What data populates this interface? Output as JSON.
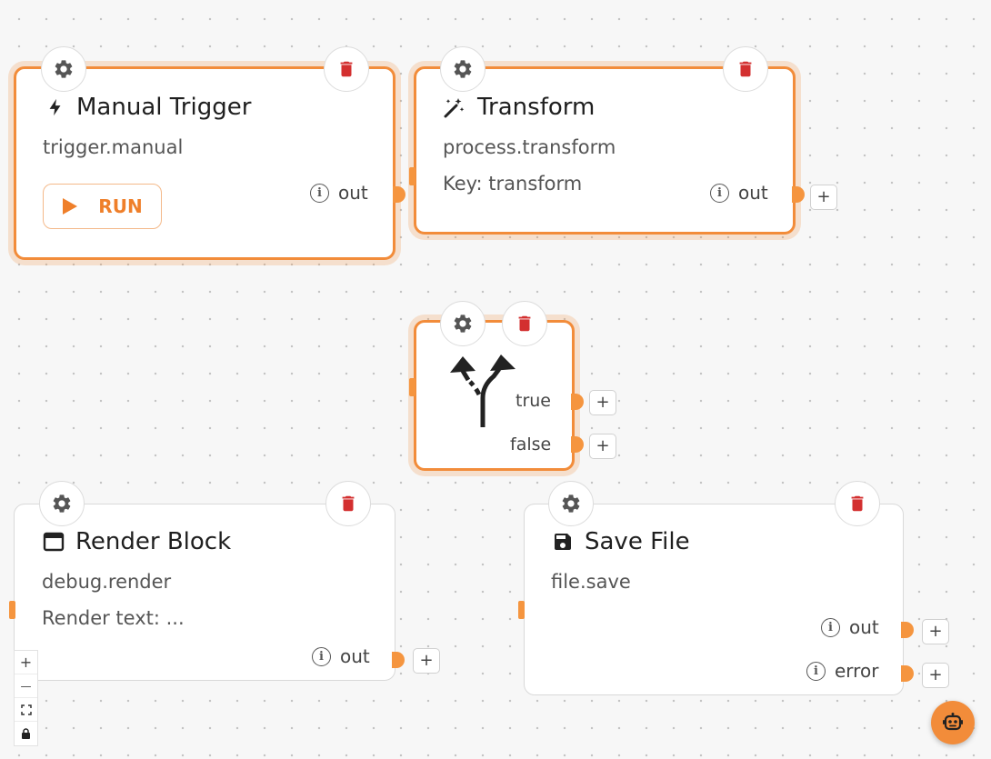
{
  "nodes": {
    "manual_trigger": {
      "title": "Manual Trigger",
      "type": "trigger.manual",
      "run_label": "RUN",
      "output": "out"
    },
    "transform": {
      "title": "Transform",
      "type": "process.transform",
      "detail": "Key: transform",
      "output": "out"
    },
    "condition": {
      "true_label": "true",
      "false_label": "false"
    },
    "render_block": {
      "title": "Render Block",
      "type": "debug.render",
      "detail": "Render text: ...",
      "output": "out"
    },
    "save_file": {
      "title": "Save File",
      "type": "file.save",
      "output": "out",
      "error": "error"
    }
  },
  "controls": {
    "plus": "+",
    "zoom_in": "+",
    "zoom_out": "—"
  },
  "colors": {
    "accent": "#f28c3a",
    "delete": "#d32f2f",
    "background": "#f7f7f7"
  },
  "icons": {
    "settings": "gear-icon",
    "delete": "trash-icon",
    "trigger": "lightning-icon",
    "transform": "magic-wand-icon",
    "condition": "fork-arrows-icon",
    "render": "window-icon",
    "save": "floppy-disk-icon",
    "assistant": "robot-icon"
  }
}
